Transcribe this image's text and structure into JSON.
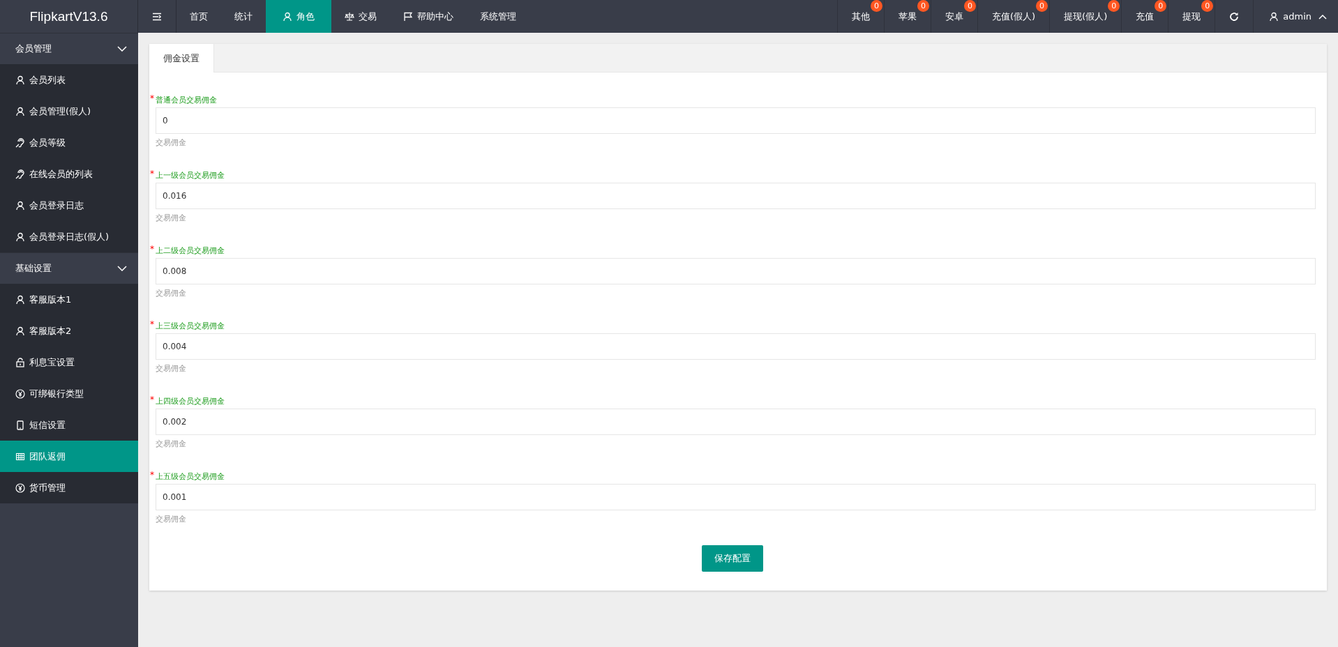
{
  "logo": "FlipkartV13.6",
  "nav": [
    {
      "label": "首页",
      "selected": false
    },
    {
      "label": "统计",
      "selected": false
    },
    {
      "label": "角色",
      "selected": true,
      "kind": "user"
    },
    {
      "label": "交易",
      "selected": false,
      "kind": "scale"
    },
    {
      "label": "帮助中心",
      "selected": false,
      "kind": "flag"
    },
    {
      "label": "系统管理",
      "selected": false
    }
  ],
  "right_nav": [
    {
      "label": "其他",
      "badge": "0"
    },
    {
      "label": "苹果",
      "badge": "0"
    },
    {
      "label": "安卓",
      "badge": "0"
    },
    {
      "label": "充值(假人)",
      "badge": "0"
    },
    {
      "label": "提现(假人)",
      "badge": "0"
    },
    {
      "label": "充值",
      "badge": "0"
    },
    {
      "label": "提现",
      "badge": "0"
    }
  ],
  "user": "admin",
  "sidebar": [
    {
      "label": "会员管理",
      "expanded": true,
      "children": [
        {
          "label": "会员列表",
          "kind": "user",
          "selected": false
        },
        {
          "label": "会员管理(假人)",
          "kind": "user",
          "selected": false
        },
        {
          "label": "会员等级",
          "kind": "ear",
          "selected": false
        },
        {
          "label": "在线会员的列表",
          "kind": "ear",
          "selected": false
        },
        {
          "label": "会员登录日志",
          "kind": "user",
          "selected": false
        },
        {
          "label": "会员登录日志(假人)",
          "kind": "user",
          "selected": false
        }
      ]
    },
    {
      "label": "基础设置",
      "expanded": true,
      "children": [
        {
          "label": "客服版本1",
          "kind": "user",
          "selected": false
        },
        {
          "label": "客服版本2",
          "kind": "user",
          "selected": false
        },
        {
          "label": "利息宝设置",
          "kind": "lock",
          "selected": false
        },
        {
          "label": "可绑银行类型",
          "kind": "yen",
          "selected": false
        },
        {
          "label": "短信设置",
          "kind": "phone",
          "selected": false
        },
        {
          "label": "团队返佣",
          "kind": "grid",
          "selected": true
        },
        {
          "label": "货币管理",
          "kind": "yen",
          "selected": false
        }
      ]
    }
  ],
  "tabs": [
    {
      "label": "佣金设置",
      "selected": true
    }
  ],
  "fields": [
    {
      "label": "普通会员交易佣金",
      "value": "0",
      "hint": "交易佣金",
      "required_mark": "*"
    },
    {
      "label": "上一级会员交易佣金",
      "value": "0.016",
      "hint": "交易佣金",
      "required_mark": "*"
    },
    {
      "label": "上二级会员交易佣金",
      "value": "0.008",
      "hint": "交易佣金",
      "required_mark": "*"
    },
    {
      "label": "上三级会员交易佣金",
      "value": "0.004",
      "hint": "交易佣金",
      "required_mark": "*"
    },
    {
      "label": "上四级会员交易佣金",
      "value": "0.002",
      "hint": "交易佣金",
      "required_mark": "*"
    },
    {
      "label": "上五级会员交易佣金",
      "value": "0.001",
      "hint": "交易佣金",
      "required_mark": "*"
    }
  ],
  "submit": "保存配置"
}
